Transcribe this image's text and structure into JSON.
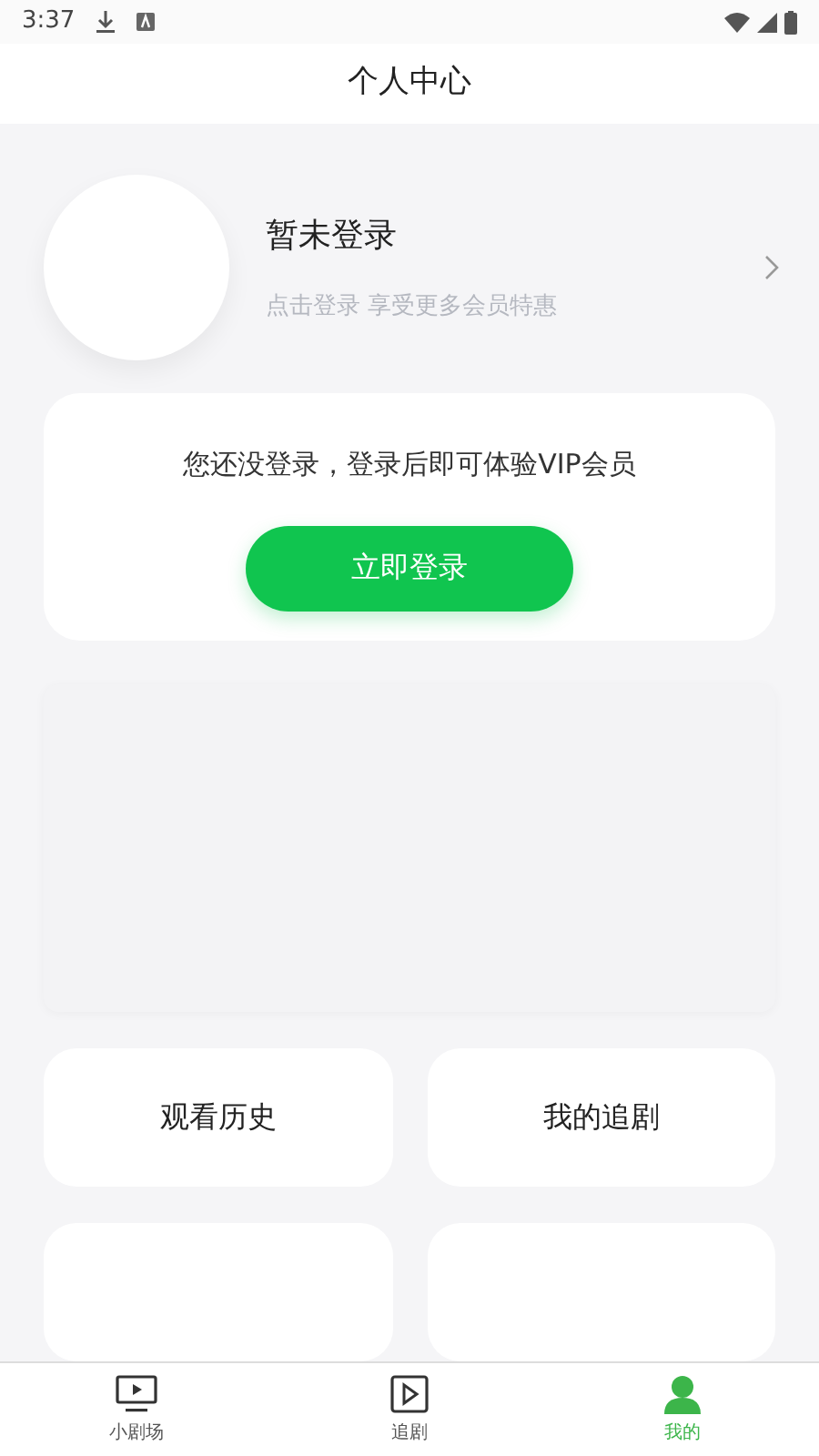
{
  "status_bar": {
    "time": "3:37"
  },
  "title": "个人中心",
  "profile": {
    "name": "暂未登录",
    "subtitle": "点击登录 享受更多会员特惠"
  },
  "login_card": {
    "message": "您还没登录，登录后即可体验VIP会员",
    "button": "立即登录"
  },
  "shortcuts": [
    {
      "label": "观看历史"
    },
    {
      "label": "我的追剧"
    }
  ],
  "tabs": [
    {
      "label": "小剧场",
      "kind": "theater",
      "selected": false
    },
    {
      "label": "追剧",
      "kind": "follow",
      "selected": false
    },
    {
      "label": "我的",
      "kind": "me",
      "selected": true
    }
  ]
}
